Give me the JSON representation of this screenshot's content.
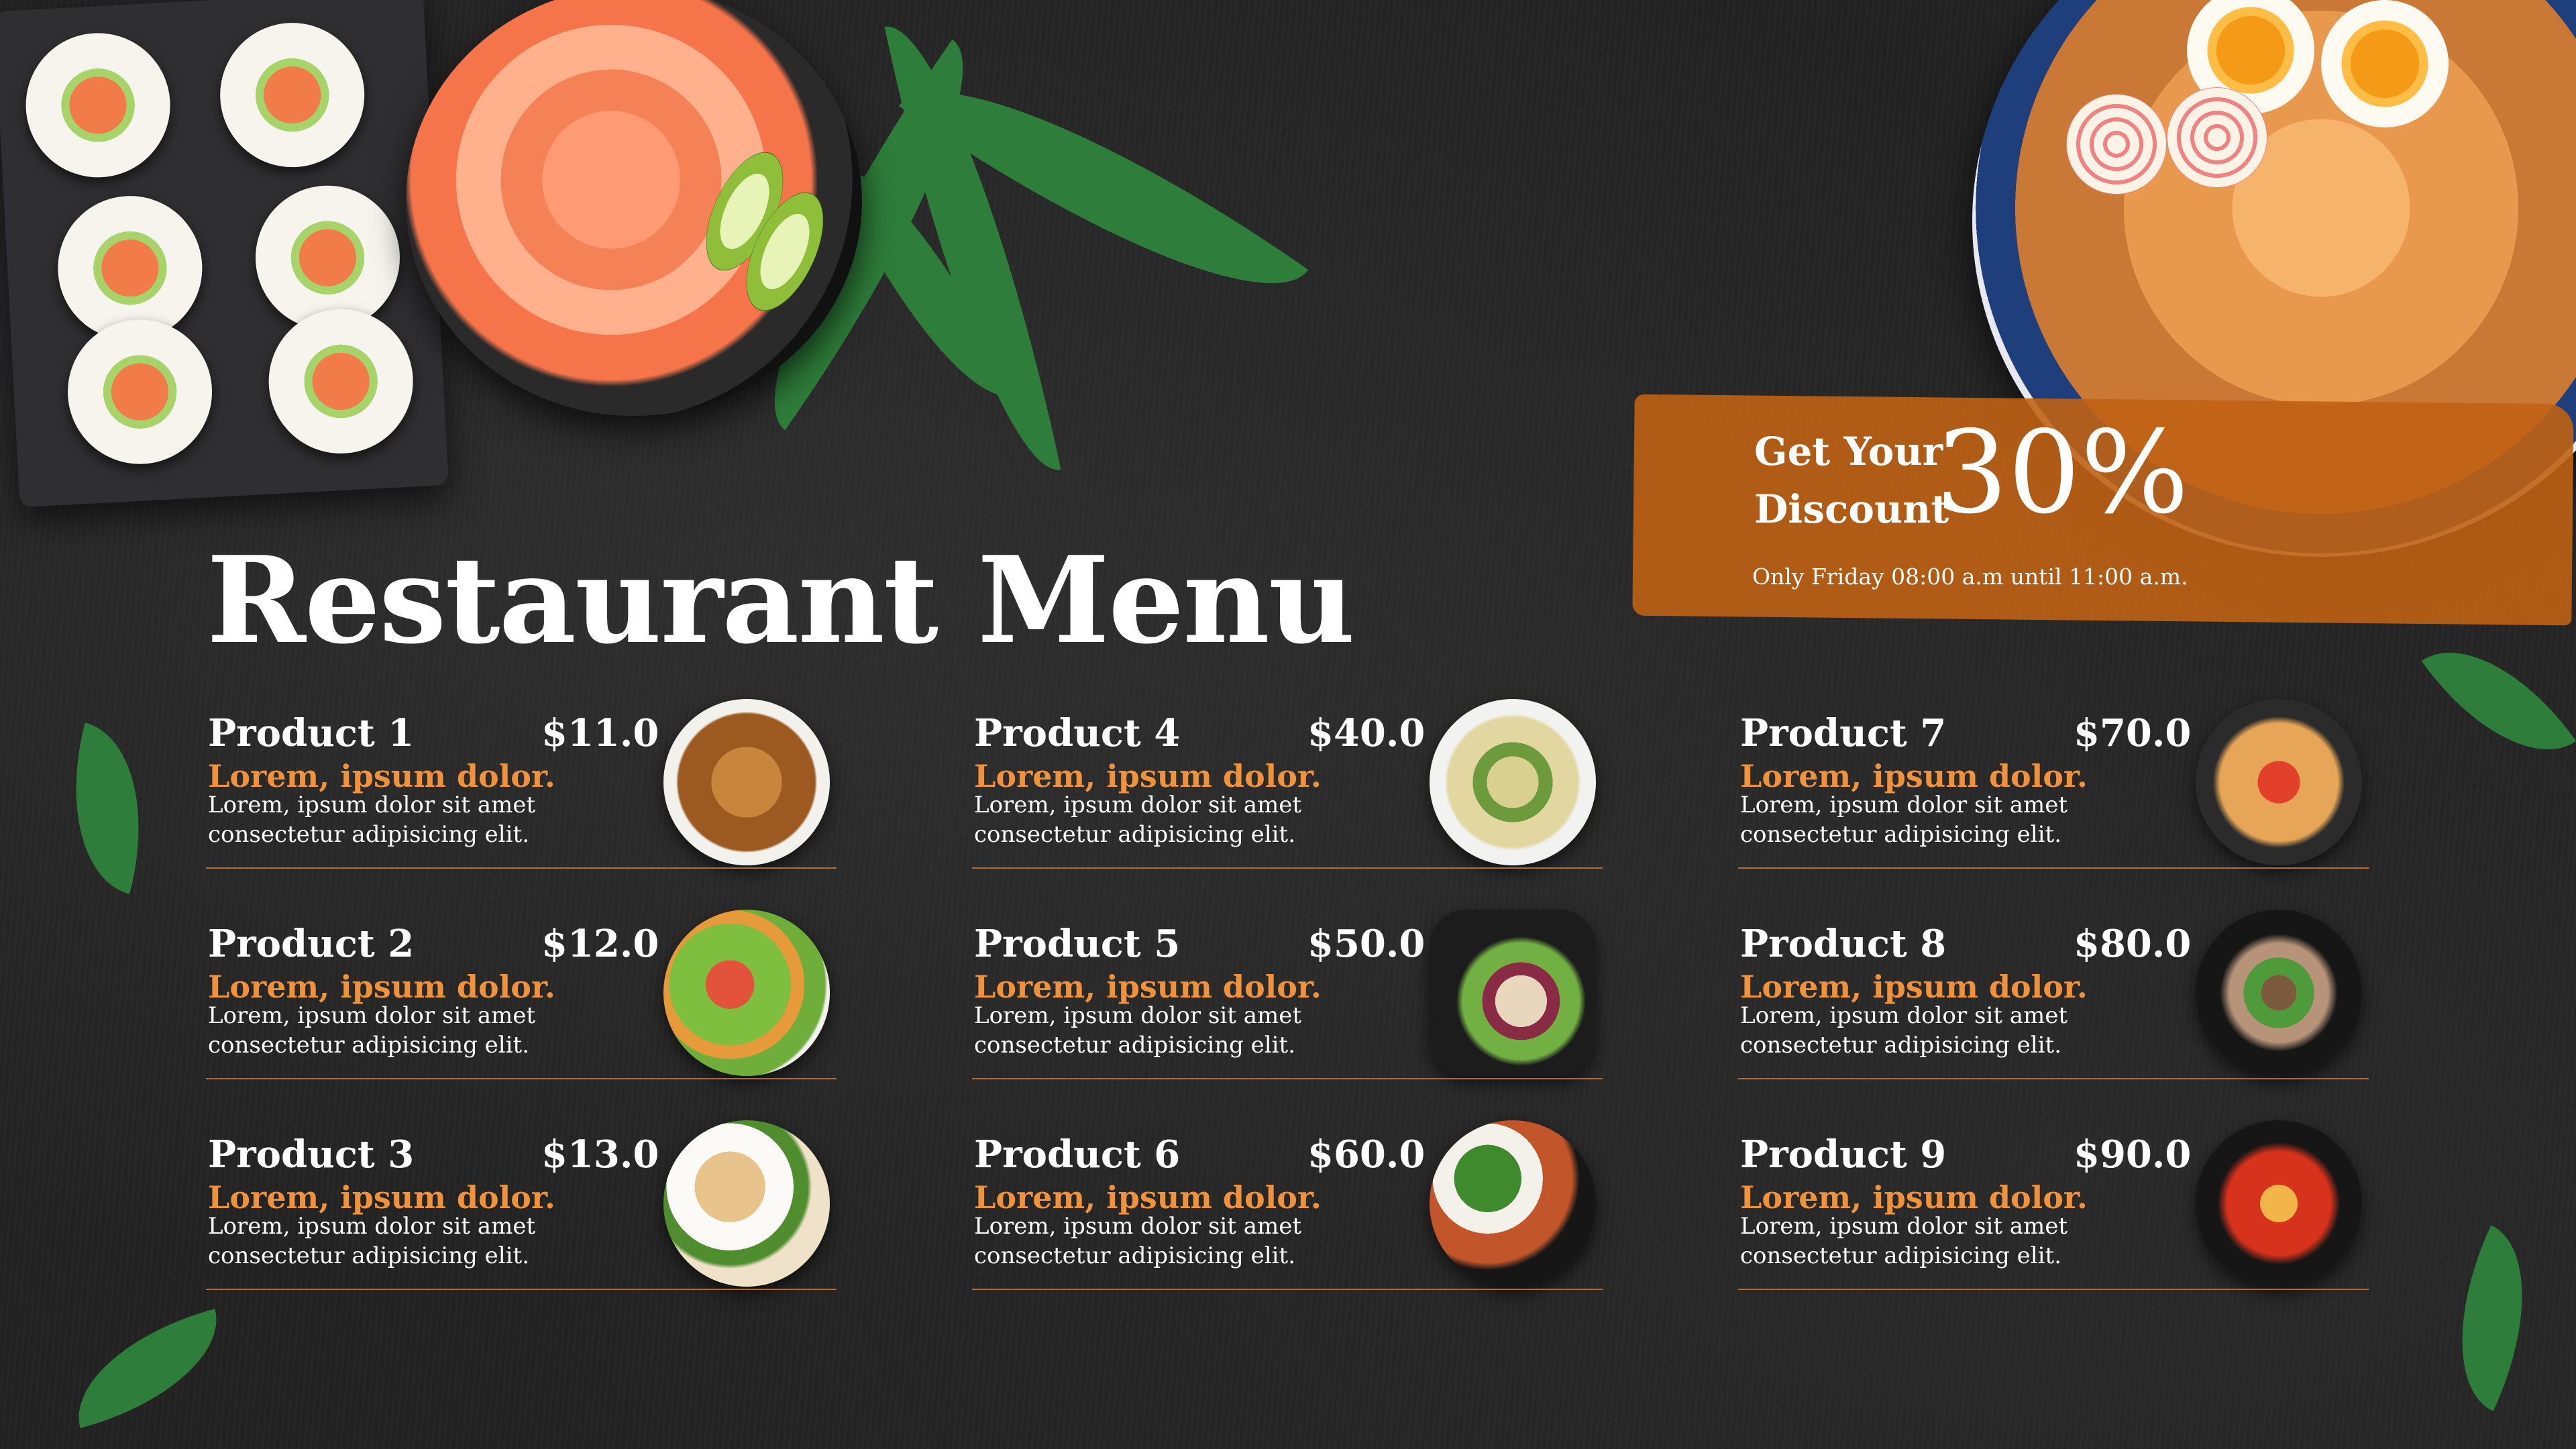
{
  "title": "Restaurant Menu",
  "promo": {
    "line1": "Get Your",
    "line2": "Discount",
    "percent": "30%",
    "note": "Only Friday 08:00 a.m until 11:00 a.m."
  },
  "colors": {
    "background": "#232323",
    "accent": "#f0913c",
    "banner": "#c06214",
    "leaf": "#2e7d3a",
    "divider": "#b56b2f"
  },
  "products": [
    {
      "name": "Product 1",
      "price": "$11.0",
      "subtitle": "Lorem, ipsum dolor.",
      "description": "Lorem, ipsum dolor sit amet consectetur adipisicing elit.",
      "image": "noodles-plate"
    },
    {
      "name": "Product 2",
      "price": "$12.0",
      "subtitle": "Lorem, ipsum dolor.",
      "description": "Lorem, ipsum dolor sit amet consectetur adipisicing elit.",
      "image": "salad-plate"
    },
    {
      "name": "Product 3",
      "price": "$13.0",
      "subtitle": "Lorem, ipsum dolor.",
      "description": "Lorem, ipsum dolor sit amet consectetur adipisicing elit.",
      "image": "chicken-rice-plate"
    },
    {
      "name": "Product 4",
      "price": "$40.0",
      "subtitle": "Lorem, ipsum dolor.",
      "description": "Lorem, ipsum dolor sit amet consectetur adipisicing elit.",
      "image": "gnocchi-plate"
    },
    {
      "name": "Product 5",
      "price": "$50.0",
      "subtitle": "Lorem, ipsum dolor.",
      "description": "Lorem, ipsum dolor sit amet consectetur adipisicing elit.",
      "image": "kebab-plate"
    },
    {
      "name": "Product 6",
      "price": "$60.0",
      "subtitle": "Lorem, ipsum dolor.",
      "description": "Lorem, ipsum dolor sit amet consectetur adipisicing elit.",
      "image": "broccoli-chicken-bowl"
    },
    {
      "name": "Product 7",
      "price": "$70.0",
      "subtitle": "Lorem, ipsum dolor.",
      "description": "Lorem, ipsum dolor sit amet consectetur adipisicing elit.",
      "image": "spaghetti-bowl"
    },
    {
      "name": "Product 8",
      "price": "$80.0",
      "subtitle": "Lorem, ipsum dolor.",
      "description": "Lorem, ipsum dolor sit amet consectetur adipisicing elit.",
      "image": "stir-fry-bowl"
    },
    {
      "name": "Product 9",
      "price": "$90.0",
      "subtitle": "Lorem, ipsum dolor.",
      "description": "Lorem, ipsum dolor sit amet consectetur adipisicing elit.",
      "image": "spicy-tofu-bowl"
    }
  ]
}
